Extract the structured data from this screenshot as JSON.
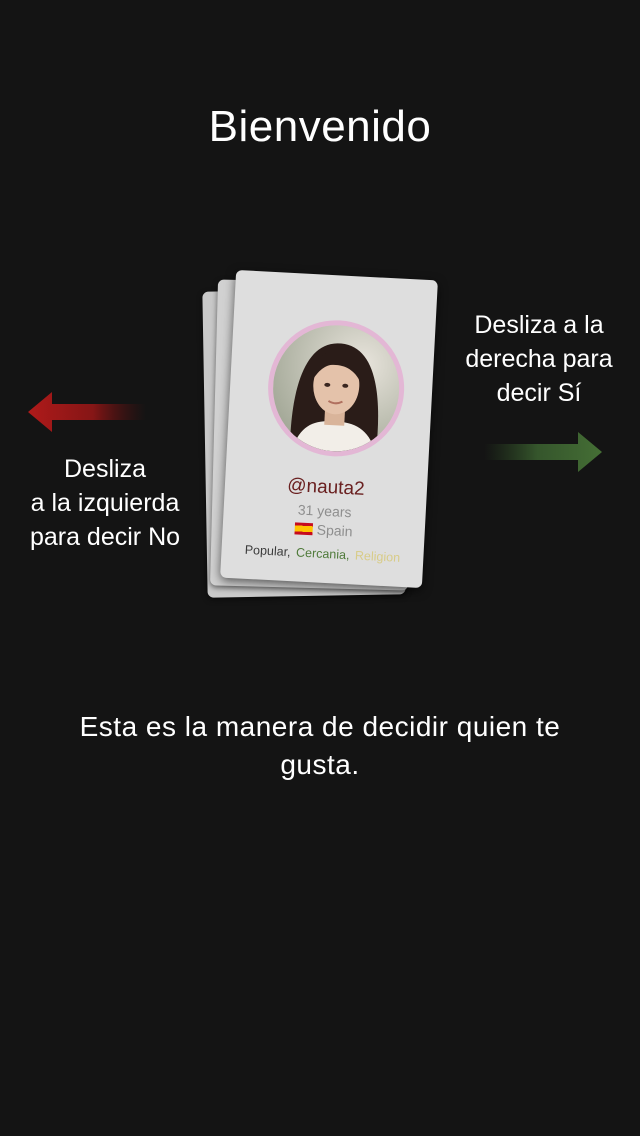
{
  "header": {
    "title": "Bienvenido"
  },
  "hints": {
    "right": "Desliza a la\nderecha para\ndecir Sí",
    "left": "Desliza\na la izquierda\npara decir No"
  },
  "card": {
    "username": "@nauta2",
    "age": "31 years",
    "country": "Spain",
    "tags": [
      {
        "label": "Popular,",
        "color": "#3a3a3a"
      },
      {
        "label": "Cercania,",
        "color": "#4f7a3a"
      },
      {
        "label": "Religion",
        "color": "#d8cc88"
      }
    ],
    "avatar_ring_color": "#e3b7d5"
  },
  "footer": {
    "tagline": "Esta es la manera de decidir quien te gusta."
  },
  "colors": {
    "background": "#141414",
    "arrow_no": "#a01818",
    "arrow_yes": "#3f6a2f"
  },
  "icons": {
    "left_arrow": "arrow-left-icon",
    "right_arrow": "arrow-right-icon",
    "flag": "spain-flag-icon"
  }
}
